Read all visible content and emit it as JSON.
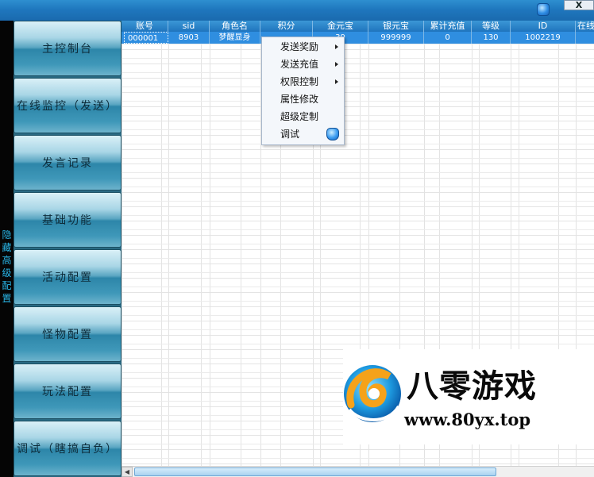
{
  "titlebar": {
    "close_label": "X",
    "icon": "app-gem-icon"
  },
  "sidebar_strip": {
    "label": "隐藏高级配置"
  },
  "nav": {
    "items": [
      {
        "label": "主控制台"
      },
      {
        "label": "在线监控（发送）"
      },
      {
        "label": "发言记录"
      },
      {
        "label": "基础功能"
      },
      {
        "label": "活动配置"
      },
      {
        "label": "怪物配置"
      },
      {
        "label": "玩法配置"
      },
      {
        "label": "调试（瞎搞自负）"
      }
    ]
  },
  "table": {
    "columns": [
      "账号",
      "sid",
      "角色名",
      "积分",
      "金元宝",
      "银元宝",
      "累计充值",
      "等级",
      "ID",
      "在线"
    ],
    "rows": [
      [
        "000001",
        "8903",
        "梦醒显身",
        "",
        "39",
        "999999",
        "0",
        "130",
        "1002219",
        ""
      ]
    ]
  },
  "context_menu": {
    "items": [
      {
        "label": "发送奖励",
        "submenu": true
      },
      {
        "label": "发送充值",
        "submenu": true
      },
      {
        "label": "权限控制",
        "submenu": true
      },
      {
        "label": "属性修改",
        "submenu": false
      },
      {
        "label": "超级定制",
        "submenu": false
      },
      {
        "label": "调试",
        "submenu": false,
        "icon": "gem-icon"
      }
    ]
  },
  "watermark": {
    "title": "八零游戏",
    "url": "www.80yx.top"
  },
  "colors": {
    "titlebar": "#1f77be",
    "selection": "#2f8ee0",
    "nav": "#2d86a9",
    "accent_text": "#29b6e8"
  }
}
